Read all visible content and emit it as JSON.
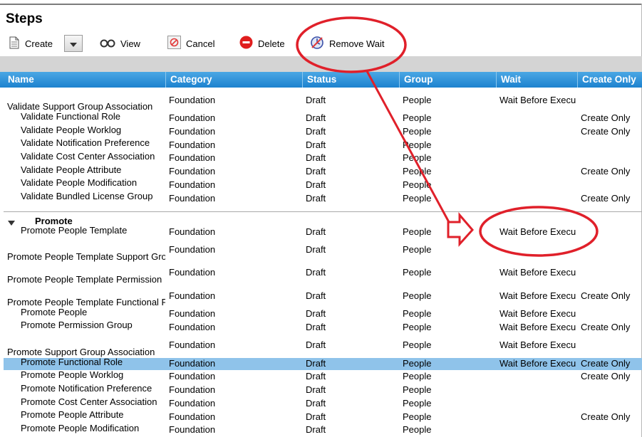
{
  "page": {
    "title": "Steps"
  },
  "toolbar": {
    "create_label": "Create",
    "view_label": "View",
    "cancel_label": "Cancel",
    "delete_label": "Delete",
    "remove_wait_label": "Remove Wait"
  },
  "columns": [
    "Name",
    "Category",
    "Status",
    "Group",
    "Wait",
    "Create Only"
  ],
  "group": {
    "name": "Promote"
  },
  "rows": [
    {
      "name": "Validate Support Group Association",
      "category": "Foundation",
      "status": "Draft",
      "group": "People",
      "wait": "Wait Before Execu",
      "create_only": ""
    },
    {
      "name": "Validate Functional Role",
      "category": "Foundation",
      "status": "Draft",
      "group": "People",
      "wait": "",
      "create_only": "Create Only"
    },
    {
      "name": "Validate People Worklog",
      "category": "Foundation",
      "status": "Draft",
      "group": "People",
      "wait": "",
      "create_only": "Create Only"
    },
    {
      "name": "Validate Notification Preference",
      "category": "Foundation",
      "status": "Draft",
      "group": "People",
      "wait": "",
      "create_only": ""
    },
    {
      "name": "Validate Cost Center Association",
      "category": "Foundation",
      "status": "Draft",
      "group": "People",
      "wait": "",
      "create_only": ""
    },
    {
      "name": "Validate People Attribute",
      "category": "Foundation",
      "status": "Draft",
      "group": "People",
      "wait": "",
      "create_only": "Create Only"
    },
    {
      "name": "Validate People Modification",
      "category": "Foundation",
      "status": "Draft",
      "group": "People",
      "wait": "",
      "create_only": ""
    },
    {
      "name": "Validate Bundled License Group",
      "category": "Foundation",
      "status": "Draft",
      "group": "People",
      "wait": "",
      "create_only": "Create Only"
    },
    {
      "name": "Promote People Template",
      "category": "Foundation",
      "status": "Draft",
      "group": "People",
      "wait": "Wait Before Execu",
      "create_only": ""
    },
    {
      "name": "Promote People Template Support Gro",
      "category": "Foundation",
      "status": "Draft",
      "group": "People",
      "wait": "",
      "create_only": ""
    },
    {
      "name": "Promote People Template Permission",
      "category": "Foundation",
      "status": "Draft",
      "group": "People",
      "wait": "Wait Before Execu",
      "create_only": ""
    },
    {
      "name": "Promote People Template Functional F",
      "category": "Foundation",
      "status": "Draft",
      "group": "People",
      "wait": "Wait Before Execu",
      "create_only": "Create Only"
    },
    {
      "name": "Promote People",
      "category": "Foundation",
      "status": "Draft",
      "group": "People",
      "wait": "Wait Before Execu",
      "create_only": ""
    },
    {
      "name": "Promote Permission Group",
      "category": "Foundation",
      "status": "Draft",
      "group": "People",
      "wait": "Wait Before Execu",
      "create_only": "Create Only"
    },
    {
      "name": "Promote Support Group Association",
      "category": "Foundation",
      "status": "Draft",
      "group": "People",
      "wait": "Wait Before Execu",
      "create_only": ""
    },
    {
      "name": "Promote Functional Role",
      "category": "Foundation",
      "status": "Draft",
      "group": "People",
      "wait": "Wait Before Execu",
      "create_only": "Create Only"
    },
    {
      "name": "Promote People Worklog",
      "category": "Foundation",
      "status": "Draft",
      "group": "People",
      "wait": "",
      "create_only": "Create Only"
    },
    {
      "name": "Promote Notification Preference",
      "category": "Foundation",
      "status": "Draft",
      "group": "People",
      "wait": "",
      "create_only": ""
    },
    {
      "name": "Promote Cost Center Association",
      "category": "Foundation",
      "status": "Draft",
      "group": "People",
      "wait": "",
      "create_only": ""
    },
    {
      "name": "Promote People Attribute",
      "category": "Foundation",
      "status": "Draft",
      "group": "People",
      "wait": "",
      "create_only": "Create Only"
    },
    {
      "name": "Promote People Modification",
      "category": "Foundation",
      "status": "Draft",
      "group": "People",
      "wait": "",
      "create_only": ""
    }
  ],
  "colors": {
    "header": "#1d82cf",
    "selected_row": "#8fc3ea",
    "annotation": "#e0202a"
  },
  "icons": [
    "document-icon",
    "chevron-down-icon",
    "glasses-icon",
    "cancel-icon",
    "delete-icon",
    "remove-wait-icon",
    "tree-collapse-icon"
  ]
}
